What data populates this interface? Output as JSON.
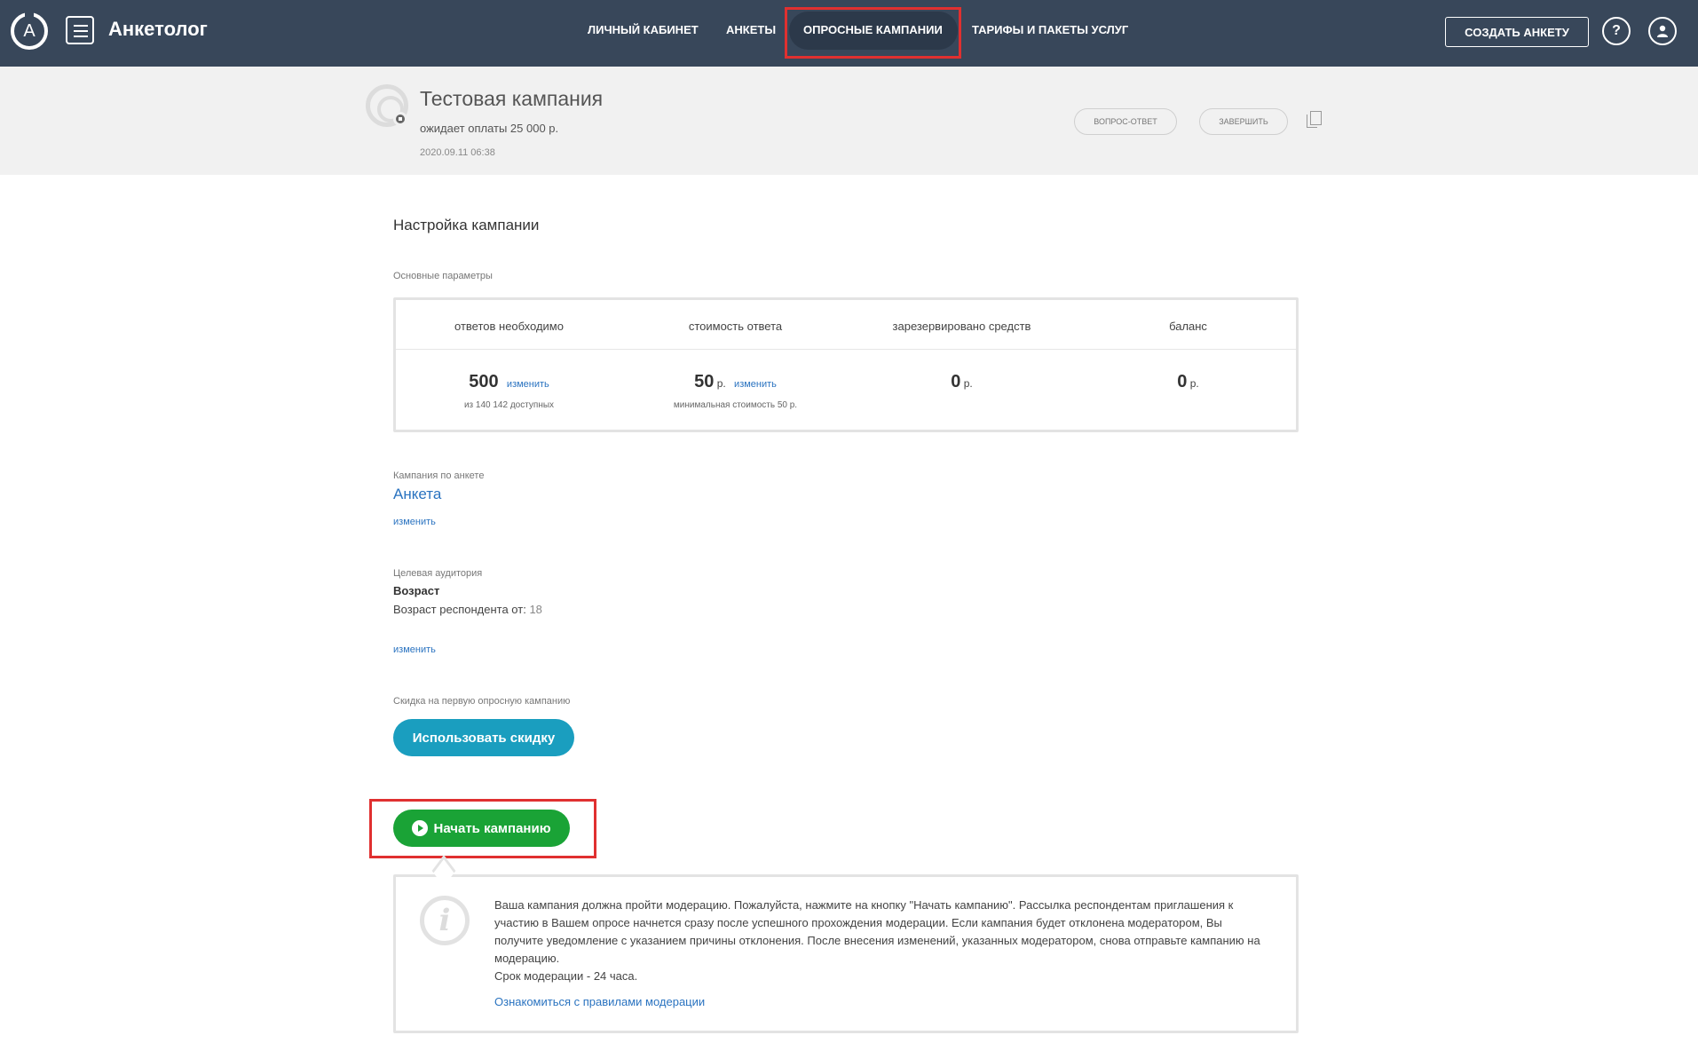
{
  "header": {
    "brand": "Анкетолог",
    "logo_letter": "A",
    "nav": [
      "ЛИЧНЫЙ КАБИНЕТ",
      "АНКЕТЫ",
      "ОПРОСНЫЕ КАМПАНИИ",
      "ТАРИФЫ И ПАКЕТЫ УСЛУГ"
    ],
    "active_nav": "ОПРОСНЫЕ КАМПАНИИ",
    "create_button": "СОЗДАТЬ АНКЕТУ",
    "help_icon_label": "?",
    "icons": [
      "logo-icon",
      "menu-icon",
      "help-icon",
      "user-icon"
    ]
  },
  "campaign": {
    "title": "Тестовая кампания",
    "status": "ожидает оплаты 25 000 р.",
    "date": "2020.09.11 06:38",
    "buttons": {
      "qa": "ВОПРОС-ОТВЕТ",
      "finish": "ЗАВЕРШИТЬ"
    }
  },
  "settings": {
    "title": "Настройка кампании",
    "basic_label": "Основные параметры",
    "params": [
      {
        "head": "ответов необходимо",
        "value": "500",
        "unit": "",
        "link": "изменить",
        "sub": "из 140 142 доступных"
      },
      {
        "head": "стоимость ответа",
        "value": "50",
        "unit": "р.",
        "link": "изменить",
        "sub": "минимальная стоимость 50 р."
      },
      {
        "head": "зарезервировано средств",
        "value": "0",
        "unit": "р.",
        "link": "",
        "sub": ""
      },
      {
        "head": "баланс",
        "value": "0",
        "unit": "р.",
        "link": "",
        "sub": ""
      }
    ],
    "survey_label": "Кампания по анкете",
    "survey_name": "Анкета",
    "survey_change": "изменить",
    "audience_label": "Целевая аудитория",
    "audience_title": "Возраст",
    "audience_text": "Возраст респондента от:",
    "audience_value": "18",
    "audience_change": "изменить",
    "discount_label": "Скидка на первую опросную кампанию",
    "discount_button": "Использовать скидку",
    "start_button": "Начать кампанию"
  },
  "info": {
    "text": "Ваша кампания должна пройти модерацию. Пожалуйста, нажмите на кнопку \"Начать кампанию\". Рассылка респондентам приглашения к участию в Вашем опросе начнется сразу после успешного прохождения модерации. Если кампания будет отклонена модератором, Вы получите уведомление с указанием причины отклонения. После внесения изменений, указанных модератором, снова отправьте кампанию на модерацию.",
    "term": "Срок модерации - 24 часа.",
    "link": "Ознакомиться с правилами модерации"
  },
  "colors": {
    "topbar": "#38475a",
    "link": "#2a73c0",
    "discount": "#1a9ebf",
    "start": "#1aa336",
    "highlight": "#e03030"
  }
}
